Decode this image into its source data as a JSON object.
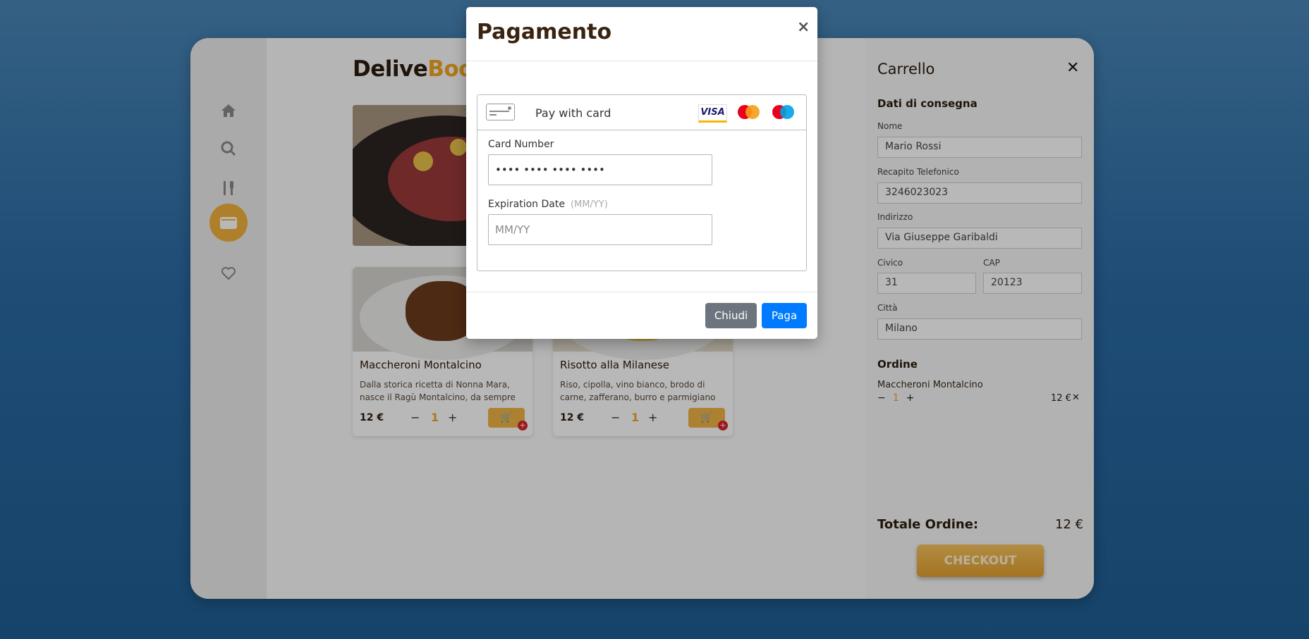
{
  "brand": {
    "part1": "Delive",
    "part2": "Boo"
  },
  "hidden_number": "5",
  "nav": [
    {
      "icon": "home-icon",
      "glyph": "⌂"
    },
    {
      "icon": "search-icon",
      "glyph": "⚲"
    },
    {
      "icon": "utensils-icon",
      "glyph": "🍴"
    },
    {
      "icon": "wallet-icon",
      "glyph": "▭"
    },
    {
      "icon": "heart-icon",
      "glyph": "♡"
    }
  ],
  "products": [
    {
      "title": "Maccheroni Montalcino",
      "desc": "Dalla storica ricetta di Nonna Mara, nasce il Ragù Montalcino, da sempre",
      "price": "12 €",
      "qty": "1",
      "minus": "−",
      "plus": "+"
    },
    {
      "title": "Risotto alla Milanese",
      "desc": "Riso, cipolla, vino bianco, brodo di carne, zafferano, burro e parmigiano",
      "price": "12 €",
      "qty": "1",
      "minus": "−",
      "plus": "+"
    }
  ],
  "cart": {
    "title": "Carrello",
    "close": "✕",
    "delivery_title": "Dati di consegna",
    "fields": {
      "name_label": "Nome",
      "name_value": "Mario Rossi",
      "phone_label": "Recapito Telefonico",
      "phone_value": "3246023023",
      "address_label": "Indirizzo",
      "address_value": "Via Giuseppe Garibaldi",
      "civic_label": "Civico",
      "civic_value": "31",
      "cap_label": "CAP",
      "cap_value": "20123",
      "city_label": "Città",
      "city_value": "Milano"
    },
    "order_title": "Ordine",
    "order_item": {
      "name": "Maccheroni Montalcino",
      "qty": "1",
      "minus": "−",
      "plus": "+",
      "price": "12 €",
      "remove": "✕"
    },
    "total_label": "Totale Ordine:",
    "total_value": "12 €",
    "checkout": "CHECKOUT"
  },
  "modal": {
    "title": "Pagamento",
    "close": "×",
    "pay_with": "Pay with card",
    "visa": "VISA",
    "card_number_label": "Card Number",
    "card_number_value": "•••• •••• •••• ••••",
    "expiry_label": "Expiration Date",
    "expiry_hint": "(MM/YY)",
    "expiry_placeholder": "MM/YY",
    "btn_close": "Chiudi",
    "btn_pay": "Paga"
  },
  "colors": {
    "accent": "#f2a522",
    "primary": "#007bff",
    "secondary": "#6c757d"
  }
}
